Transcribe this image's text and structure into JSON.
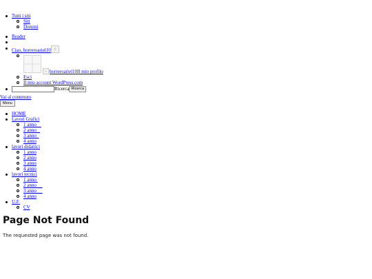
{
  "admin_bar": {
    "all_sites": "Tutti i siti",
    "sites": "Siti",
    "domains": "Domini",
    "reader": "Reader",
    "greeting": "Ciao, borreroariel10",
    "profile_user": "borreroariel10",
    "profile_link": "Il mio profilo",
    "logout": "Esci",
    "account": "Il mio account WordPress.com",
    "search_label": "Ricerca",
    "search_button": "Ricerca",
    "search_value": ""
  },
  "skip_link": "Vai al contenuto",
  "menu_button": "Menu",
  "nav": {
    "items": [
      {
        "label": "HOME"
      },
      {
        "label": "Lavori Grafici",
        "children": [
          "1 anno",
          "2 anno",
          "3 anno",
          "4 anno"
        ]
      },
      {
        "label": "lavori didattici",
        "children": [
          "1 anno",
          "2 anno",
          "3 anno",
          "4 anno"
        ]
      },
      {
        "label": "lavori tecnici",
        "children": [
          "1 anno",
          "2 anno",
          "3 anno",
          "4 anno"
        ]
      },
      {
        "label": "U.F.",
        "children": [
          "CV"
        ]
      }
    ]
  },
  "main": {
    "title": "Page Not Found",
    "message": "The requested page was not found."
  }
}
